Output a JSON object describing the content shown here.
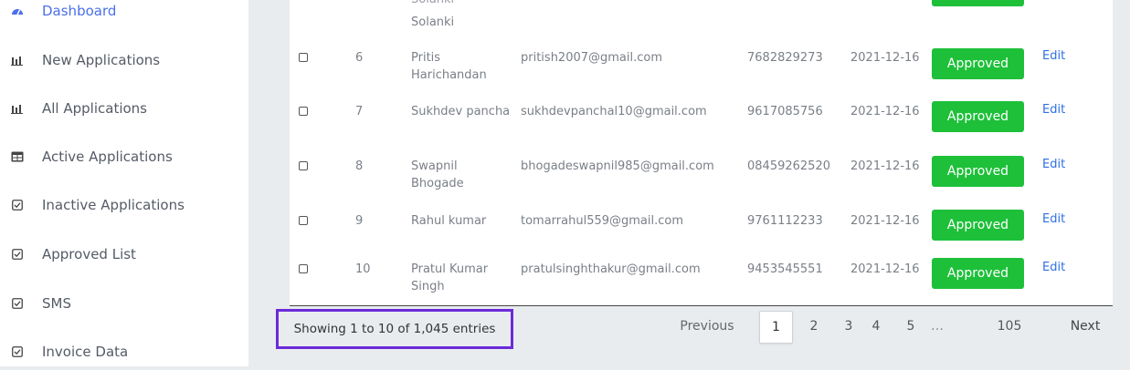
{
  "sidebar": {
    "items": [
      {
        "label": "Dashboard",
        "icon": "dashboard-gauge-icon",
        "active": true
      },
      {
        "label": "New Applications",
        "icon": "bar-chart-icon"
      },
      {
        "label": "All Applications",
        "icon": "bar-chart-icon"
      },
      {
        "label": "Active Applications",
        "icon": "table-icon"
      },
      {
        "label": "Inactive Applications",
        "icon": "checkbox-icon"
      },
      {
        "label": "Approved List",
        "icon": "checkbox-icon"
      },
      {
        "label": "SMS",
        "icon": "checkbox-icon"
      },
      {
        "label": "Invoice Data",
        "icon": "checkbox-icon"
      }
    ],
    "active_color": "#4a6fe8"
  },
  "table": {
    "partial_top_row": {
      "name_line1": "Solanki",
      "name_line2": "Solanki"
    },
    "rows": [
      {
        "no": "6",
        "name": "Pritis Harichandan",
        "email": "pritish2007@gmail.com",
        "phone": "7682829273",
        "date": "2021-12-16",
        "status": "Approved",
        "action": "Edit"
      },
      {
        "no": "7",
        "name": "Sukhdev pancha",
        "email": "sukhdevpanchal10@gmail.com",
        "phone": "9617085756",
        "date": "2021-12-16",
        "status": "Approved",
        "action": "Edit"
      },
      {
        "no": "8",
        "name": "Swapnil Bhogade",
        "email": "bhogadeswapnil985@gmail.com",
        "phone": "08459262520",
        "date": "2021-12-16",
        "status": "Approved",
        "action": "Edit"
      },
      {
        "no": "9",
        "name": "Rahul kumar",
        "email": "tomarrahul559@gmail.com",
        "phone": "9761112233",
        "date": "2021-12-16",
        "status": "Approved",
        "action": "Edit"
      },
      {
        "no": "10",
        "name": "Pratul Kumar Singh",
        "email": "pratulsinghthakur@gmail.com",
        "phone": "9453545551",
        "date": "2021-12-16",
        "status": "Approved",
        "action": "Edit"
      }
    ],
    "status_color": "#1ec03a",
    "link_color": "#2f6fe4"
  },
  "footer": {
    "info": "Showing 1 to 10 of 1,045 entries",
    "pagination": {
      "previous": "Previous",
      "pages": [
        "1",
        "2",
        "3",
        "4",
        "5",
        "…",
        "105"
      ],
      "current": "1",
      "next": "Next"
    },
    "highlight_color": "#6b2bd9"
  }
}
